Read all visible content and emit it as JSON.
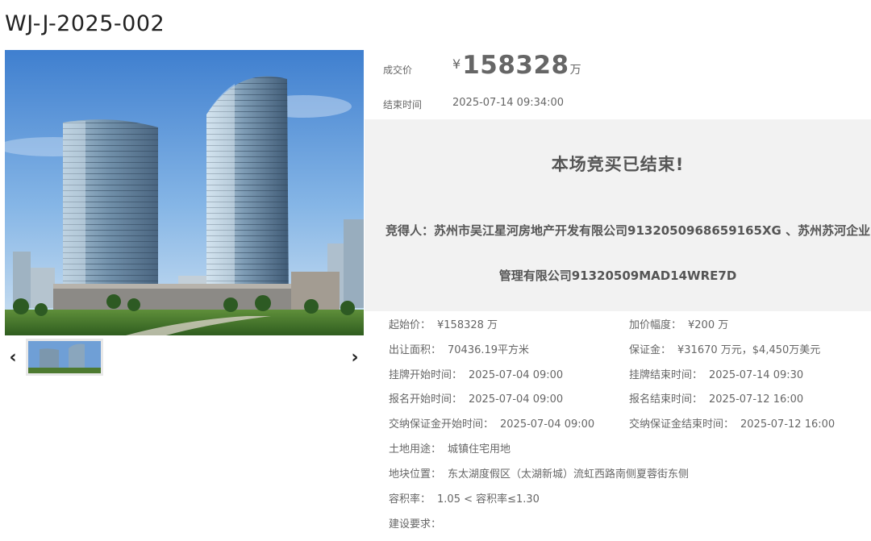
{
  "lot": {
    "title": "WJ-J-2025-002"
  },
  "gallery": {
    "prev_icon": "chevron-left-icon",
    "next_icon": "chevron-right-icon"
  },
  "price": {
    "label": "成交价",
    "currency": "¥",
    "value": "158328",
    "unit": "万"
  },
  "end_time": {
    "label": "结束时间",
    "value": "2025-07-14 09:34:00"
  },
  "result": {
    "title": "本场竞买已结束!",
    "winner_line1": "竞得人：苏州市吴江星河房地产开发有限公司9132050968659165XG 、苏州苏河企业",
    "winner_line2": "管理有限公司91320509MAD14WRE7D"
  },
  "details": {
    "start_price": {
      "label": "起始价：",
      "value": "¥158328 万"
    },
    "increment": {
      "label": "加价幅度：",
      "value": "¥200 万"
    },
    "area": {
      "label": "出让面积：",
      "value": "70436.19平方米"
    },
    "deposit": {
      "label": "保证金：",
      "value": "¥31670 万元，$4,450万美元"
    },
    "listing_start": {
      "label": "挂牌开始时间：",
      "value": "2025-07-04 09:00"
    },
    "listing_end": {
      "label": "挂牌结束时间：",
      "value": "2025-07-14 09:30"
    },
    "signup_start": {
      "label": "报名开始时间：",
      "value": "2025-07-04 09:00"
    },
    "signup_end": {
      "label": "报名结束时间：",
      "value": "2025-07-12 16:00"
    },
    "deposit_start": {
      "label": "交纳保证金开始时间：",
      "value": "2025-07-04 09:00"
    },
    "deposit_end": {
      "label": "交纳保证金结束时间：",
      "value": "2025-07-12 16:00"
    },
    "land_use": {
      "label": "土地用途：",
      "value": "城镇住宅用地"
    },
    "location": {
      "label": "地块位置：",
      "value": "东太湖度假区（太湖新城）流虹西路南侧夏蓉街东侧"
    },
    "far": {
      "label": "容积率：",
      "value": "1.05 < 容积率≤1.30"
    },
    "build_req": {
      "label": "建设要求：",
      "value": ""
    }
  }
}
